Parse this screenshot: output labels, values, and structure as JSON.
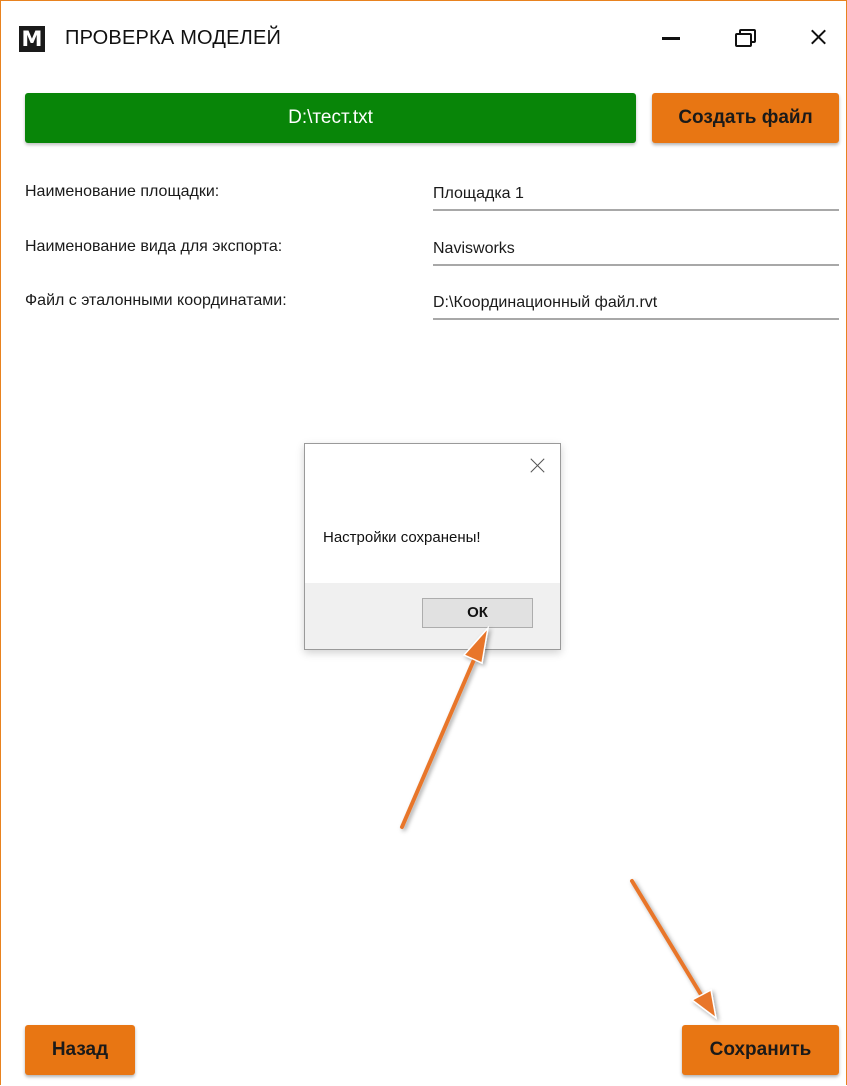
{
  "window": {
    "logo_letter": "M",
    "title": "ПРОВЕРКА МОДЕЛЕЙ"
  },
  "file_bar": {
    "path": "D:\\тест.txt",
    "create_button_label": "Создать файл"
  },
  "form": {
    "fields": [
      {
        "label": "Наименование площадки:",
        "value": "Площадка 1"
      },
      {
        "label": "Наименование вида для экспорта:",
        "value": "Navisworks"
      },
      {
        "label": "Файл с эталонными координатами:",
        "value": "D:\\Координационный файл.rvt"
      }
    ]
  },
  "dialog": {
    "message": "Настройки сохранены!",
    "ok_label": "ОК"
  },
  "footer": {
    "back_label": "Назад",
    "save_label": "Сохранить"
  },
  "colors": {
    "path_bar": "#088508",
    "accent_button": "#e87613",
    "window_border": "#e8821f",
    "annotation_arrow": "#e8762a"
  },
  "icons": {
    "logo": "app-logo-icon",
    "minimize": "minimize-icon",
    "restore": "restore-icon",
    "close": "close-icon",
    "dialog_close": "dialog-close-icon",
    "annotation": "arrow-annotation"
  }
}
